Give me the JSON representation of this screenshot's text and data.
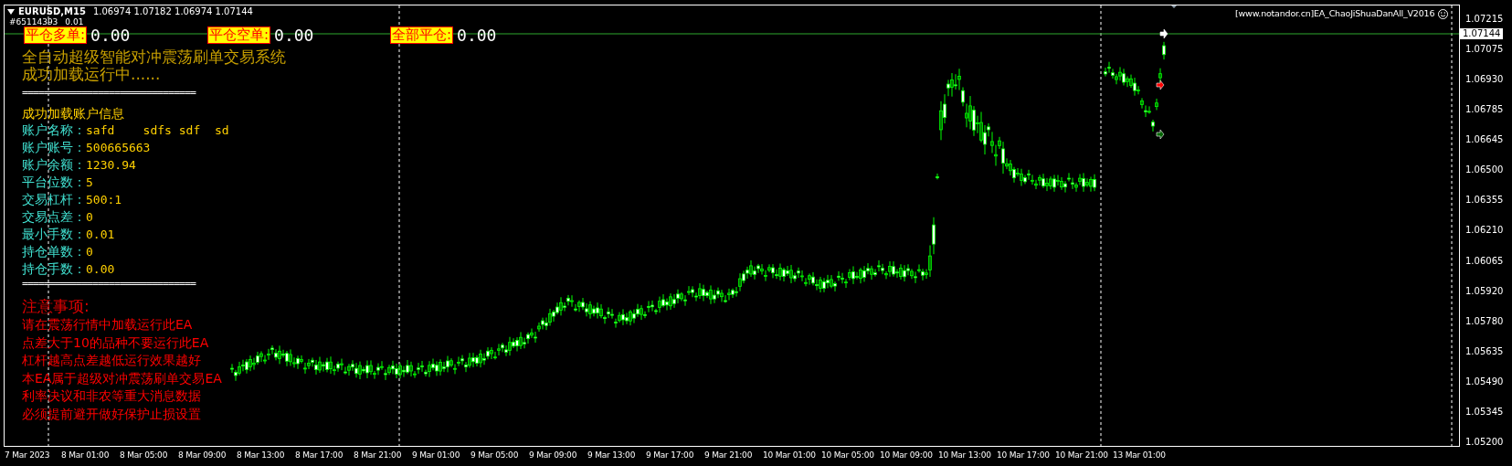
{
  "header": {
    "symbol": "EURUSD,M15",
    "prices": "1.06974 1.07182 1.06974 1.07144"
  },
  "order_label": "#65114393",
  "order_lots": "0.01",
  "close_buttons": [
    {
      "label": "平仓多单:",
      "value": "0.00"
    },
    {
      "label": "平仓空单:",
      "value": "0.00"
    },
    {
      "label": "全部平仓:",
      "value": "0.00"
    }
  ],
  "title_lines": [
    "全自动超级智能对冲震荡刷单交易系统",
    "成功加载运行中......"
  ],
  "separator_top": "================================",
  "account_heading": "成功加载账户信息",
  "account_rows": [
    {
      "label": "账户名称：",
      "value": "safd    sdfs sdf  sd"
    },
    {
      "label": "账户账号：",
      "value": "500665663"
    },
    {
      "label": "账户余额：",
      "value": "1230.94"
    },
    {
      "label": "平台位数：",
      "value": "5"
    },
    {
      "label": "交易杠杆：",
      "value": "500:1"
    },
    {
      "label": "交易点差：",
      "value": "0"
    },
    {
      "label": "最小手数：",
      "value": "0.01"
    },
    {
      "label": "持仓单数：",
      "value": "0"
    },
    {
      "label": "持仓手数：",
      "value": "0.00"
    }
  ],
  "separator_bottom": "================================",
  "notice_title": "注意事项:",
  "notices": [
    "请在震荡行情中加载运行此EA",
    "点差大于10的品种不要运行此EA",
    "杠杆越高点差越低运行效果越好",
    "本EA属于超级对冲震荡刷单交易EA",
    "利率决议和非农等重大消息数据",
    "必须提前避开做好保护止损设置"
  ],
  "ea_label": "[www.notandor.cn]EA_ChaoJiShuaDanAll_V2016",
  "price_axis": {
    "ticks": [
      "1.07215",
      "1.07075",
      "1.06930",
      "1.06785",
      "1.06645",
      "1.06500",
      "1.06355",
      "1.06210",
      "1.06065",
      "1.05920",
      "1.05780",
      "1.05635",
      "1.05490",
      "1.05345",
      "1.05200"
    ],
    "current": "1.07144"
  },
  "time_axis": [
    "7 Mar 2023",
    "8 Mar 01:00",
    "8 Mar 05:00",
    "8 Mar 09:00",
    "8 Mar 13:00",
    "8 Mar 17:00",
    "8 Mar 21:00",
    "9 Mar 01:00",
    "9 Mar 05:00",
    "9 Mar 09:00",
    "9 Mar 13:00",
    "9 Mar 17:00",
    "9 Mar 21:00",
    "10 Mar 01:00",
    "10 Mar 05:00",
    "10 Mar 09:00",
    "10 Mar 13:00",
    "10 Mar 17:00",
    "10 Mar 21:00",
    "13 Mar 01:00"
  ]
}
